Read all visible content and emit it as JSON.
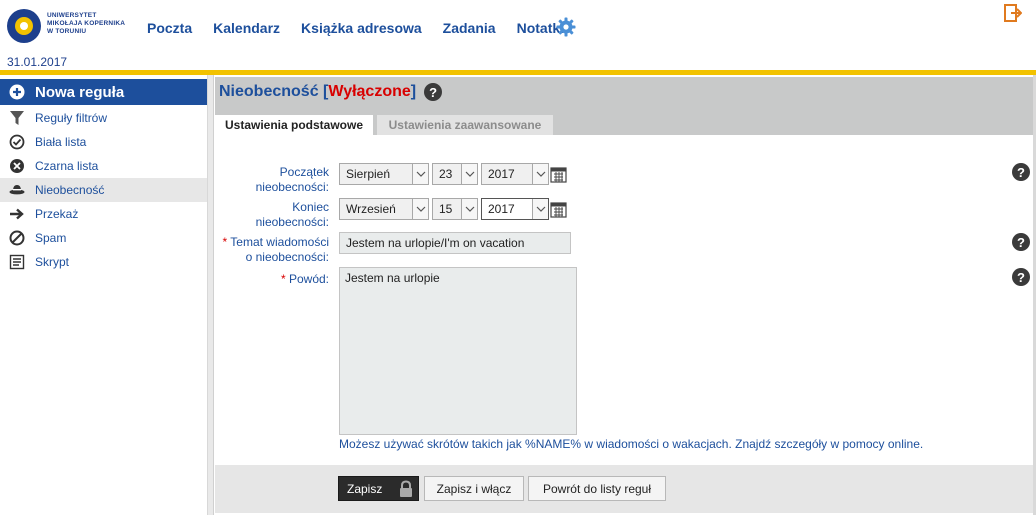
{
  "brand": {
    "logo_lines": [
      "UNIWERSYTET",
      "MIKOŁAJA KOPERNIKA",
      "W TORUNIU"
    ],
    "accent": "#1d4f9c",
    "highlight": "#f2c200"
  },
  "topnav": {
    "items": [
      "Poczta",
      "Kalendarz",
      "Książka adresowa",
      "Zadania",
      "Notatki"
    ],
    "settings_icon": "gear-icon",
    "logout_icon": "logout-icon"
  },
  "date": "31.01.2017",
  "sidebar": {
    "new_rule": "Nowa reguła",
    "items": [
      {
        "label": "Reguły filtrów",
        "icon": "filter-icon"
      },
      {
        "label": "Biała lista",
        "icon": "check-circle-icon"
      },
      {
        "label": "Czarna lista",
        "icon": "x-circle-icon"
      },
      {
        "label": "Nieobecność",
        "icon": "vacation-hat-icon"
      },
      {
        "label": "Przekaż",
        "icon": "arrow-right-icon"
      },
      {
        "label": "Spam",
        "icon": "forbidden-icon"
      },
      {
        "label": "Skrypt",
        "icon": "script-icon"
      }
    ]
  },
  "main": {
    "title": "Nieobecność",
    "status": "Wyłączone",
    "tabs": [
      {
        "label": "Ustawienia podstawowe",
        "active": true
      },
      {
        "label": "Ustawienia zaawansowane",
        "active": false
      }
    ],
    "form": {
      "start_label_1": "Początek",
      "start_label_2": "nieobecności:",
      "start_month": "Sierpień",
      "start_day": "23",
      "start_year": "2017",
      "end_label_1": "Koniec",
      "end_label_2": "nieobecności:",
      "end_month": "Wrzesień",
      "end_day": "15",
      "end_year": "2017",
      "subject_label_1": "Temat wiadomości",
      "subject_label_2": "o nieobecności:",
      "subject_value": "Jestem na urlopie/I'm on vacation",
      "reason_label": "Powód:",
      "reason_value": "Jestem na urlopie",
      "required_mark": "*",
      "hint": "Możesz używać skrótów takich jak %NAME% w wiadomości o wakacjach. Znajdź szczegóły w pomocy online."
    },
    "buttons": {
      "save": "Zapisz",
      "save_enable": "Zapisz i włącz",
      "back": "Powrót do listy reguł"
    }
  }
}
